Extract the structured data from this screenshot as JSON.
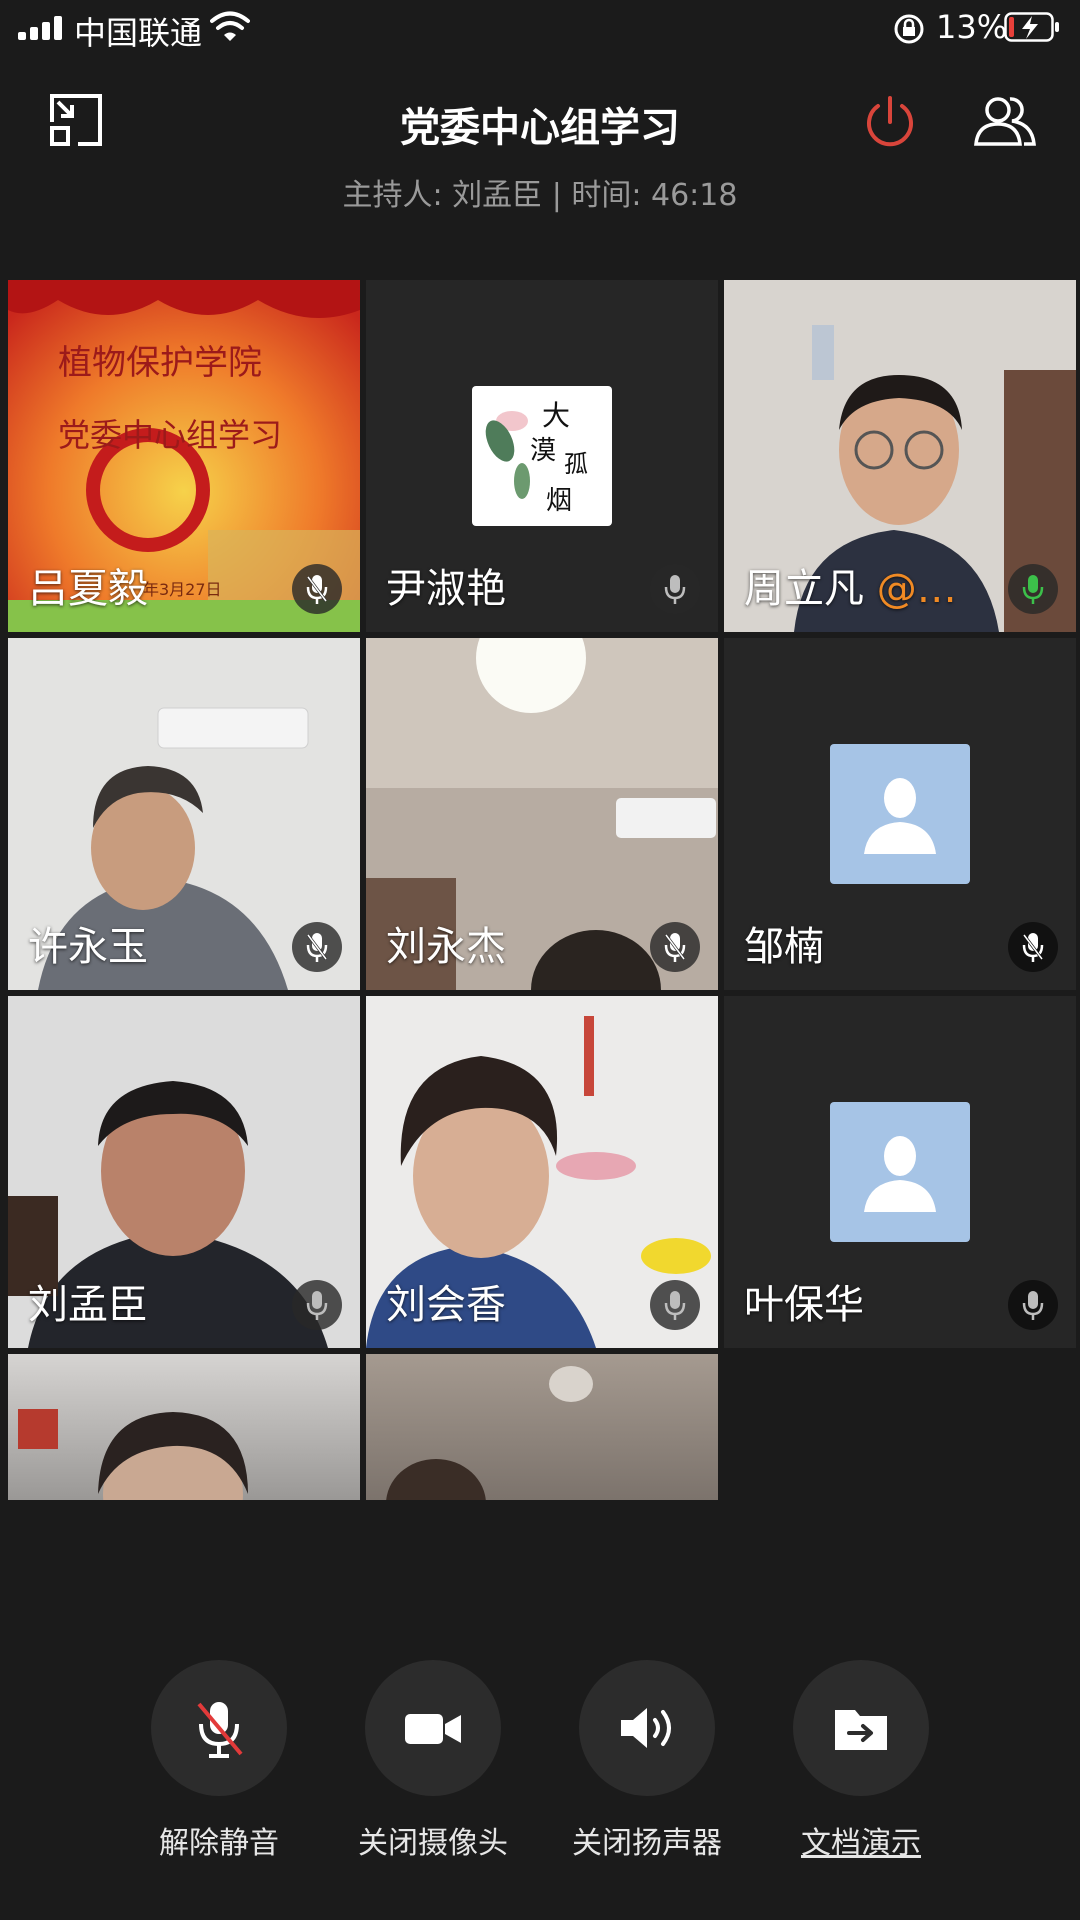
{
  "status_bar": {
    "carrier": "中国联通",
    "battery_percent": "13%"
  },
  "header": {
    "title": "党委中心组学习",
    "subtitle": "主持人: 刘孟臣 | 时间: 46:18"
  },
  "slide_overlay": {
    "line1": "植物保护学院",
    "line2": "党委中心组学习",
    "date_fragment": "年3月27日"
  },
  "logo_text": [
    "大",
    "漠",
    "孤",
    "烟"
  ],
  "participants": [
    {
      "name": "吕夏毅",
      "mic": "muted"
    },
    {
      "name": "尹淑艳",
      "mic": "on"
    },
    {
      "name": "周立凡",
      "suffix": "@…",
      "mic": "speaking"
    },
    {
      "name": "许永玉",
      "mic": "muted"
    },
    {
      "name": "刘永杰",
      "mic": "muted"
    },
    {
      "name": "邹楠",
      "mic": "muted"
    },
    {
      "name": "刘孟臣",
      "mic": "on"
    },
    {
      "name": "刘会香",
      "mic": "on"
    },
    {
      "name": "叶保华",
      "mic": "on"
    }
  ],
  "controls": [
    {
      "label": "解除静音",
      "icon": "muted-mic-icon"
    },
    {
      "label": "关闭摄像头",
      "icon": "camera-icon"
    },
    {
      "label": "关闭扬声器",
      "icon": "speaker-icon"
    },
    {
      "label": "文档演示",
      "icon": "folder-share-icon"
    }
  ],
  "colors": {
    "background": "#1b1b1b",
    "power": "#d9453b",
    "speaking_mic": "#3cc04a",
    "mention": "#f08a24",
    "avatar_bg": "#a6c4e6"
  }
}
